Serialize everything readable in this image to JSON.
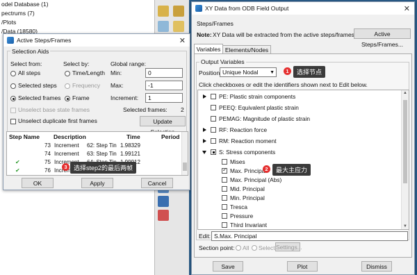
{
  "background": {
    "tree_items": [
      "odel Database (1)",
      "pectrums (7)",
      "/Plots",
      "/Data (18580)"
    ]
  },
  "active_steps": {
    "title": "Active Steps/Frames",
    "close": "✕",
    "selection_aids": "Selection Aids",
    "select_from": "Select from:",
    "select_by": "Select by:",
    "global_range": "Global range:",
    "opt_all_steps": "All steps",
    "opt_selected_steps": "Selected steps",
    "opt_selected_frames": "Selected frames",
    "opt_time_length": "Time/Length",
    "opt_frequency": "Frequency",
    "opt_frame": "Frame",
    "min_label": "Min:",
    "min_value": "0",
    "max_label": "Max:",
    "max_value": "-1",
    "increment_label": "Increment:",
    "increment_value": "1",
    "unselect_base": "Unselect base state frames",
    "unselect_duplicate": "Unselect duplicate first frames",
    "selected_frames_label": "Selected frames:",
    "selected_frames_value": "2",
    "update_selection": "Update Selection",
    "columns": [
      "Step Name",
      "Description",
      "Time",
      "Period"
    ],
    "rows": [
      {
        "check": "",
        "num": "73",
        "type": "Increment",
        "desc": "62: Step Tin",
        "time": "1.98329"
      },
      {
        "check": "",
        "num": "74",
        "type": "Increment",
        "desc": "63: Step Tin",
        "time": "1.99121"
      },
      {
        "check": "✔",
        "num": "75",
        "type": "Increment",
        "desc": "64: Step Tin",
        "time": "1.99912"
      },
      {
        "check": "✔",
        "num": "76",
        "type": "Increment",
        "desc": "",
        "time": ""
      }
    ],
    "callout_num": "3",
    "callout_text": "选择step2的最后两帧",
    "ok": "OK",
    "apply": "Apply",
    "cancel": "Cancel"
  },
  "xy_dialog": {
    "title": "XY Data from ODB Field Output",
    "close": "✕",
    "steps_frames_label": "Steps/Frames",
    "note_prefix": "Note:",
    "note_text": "XY Data will be extracted from the active steps/frames",
    "active_steps_btn": "Active Steps/Frames...",
    "tabs": [
      "Variables",
      "Elements/Nodes"
    ],
    "output_variables_label": "Output Variables",
    "position_label": "Position:",
    "position_value": "Unique Nodal",
    "callout1_num": "1",
    "callout1_text": "选择节点",
    "instructions": "Click checkboxes or edit the identifiers shown next to Edit below.",
    "tree": [
      {
        "label": "PE: Plastic strain components",
        "level": 0,
        "expand": "right"
      },
      {
        "label": "PEEQ: Equivalent plastic strain",
        "level": 0,
        "expand": ""
      },
      {
        "label": "PEMAG: Magnitude of plastic strain",
        "level": 0,
        "expand": ""
      },
      {
        "label": "RF: Reaction force",
        "level": 0,
        "expand": "right"
      },
      {
        "label": "RM: Reaction moment",
        "level": 0,
        "expand": "right"
      },
      {
        "label": "S: Stress components",
        "level": 0,
        "expand": "down",
        "state": "partial"
      },
      {
        "label": "Mises",
        "level": 1,
        "expand": ""
      },
      {
        "label": "Max. Principal",
        "level": 1,
        "expand": "",
        "state": "checked"
      },
      {
        "label": "Max. Principal (Abs)",
        "level": 1,
        "expand": ""
      },
      {
        "label": "Mid. Principal",
        "level": 1,
        "expand": ""
      },
      {
        "label": "Min. Principal",
        "level": 1,
        "expand": ""
      },
      {
        "label": "Tresca",
        "level": 1,
        "expand": ""
      },
      {
        "label": "Pressure",
        "level": 1,
        "expand": ""
      },
      {
        "label": "Third Invariant",
        "level": 1,
        "expand": ""
      }
    ],
    "callout2_num": "2",
    "callout2_text": "最大主应力",
    "edit_label": "Edit:",
    "edit_value": "S.Max. Principal",
    "section_point_label": "Section point:",
    "sp_all": "All",
    "sp_select": "Select",
    "sp_settings": "Settings...",
    "save": "Save",
    "plot": "Plot",
    "dismiss": "Dismiss"
  }
}
